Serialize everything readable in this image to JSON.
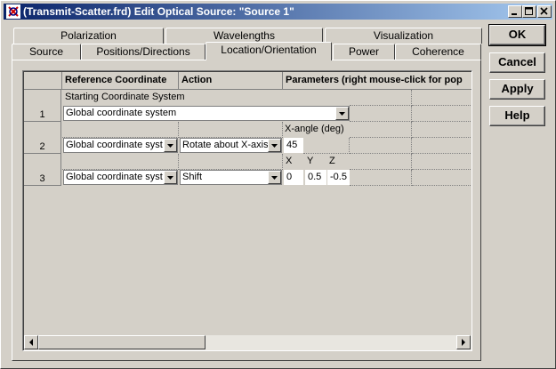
{
  "window": {
    "title": "(Transmit-Scatter.frd) Edit Optical Source: \"Source 1\""
  },
  "tabs": {
    "row1": [
      "Polarization",
      "Wavelengths",
      "Visualization"
    ],
    "row2": [
      "Source",
      "Positions/Directions",
      "Location/Orientation",
      "Power",
      "Coherence"
    ],
    "active": "Location/Orientation"
  },
  "grid": {
    "headers": [
      "Reference Coordinate",
      "Action",
      "Parameters (right mouse-click for pop"
    ],
    "rows": [
      {
        "number": "1",
        "label": "Starting Coordinate System",
        "reference": "Global coordinate system"
      },
      {
        "number": "2",
        "reference": "Global coordinate syst",
        "action": "Rotate about X-axis",
        "param_label": "X-angle (deg)",
        "param_value": "45"
      },
      {
        "number": "3",
        "reference": "Global coordinate syst",
        "action": "Shift",
        "param_labels": [
          "X",
          "Y",
          "Z"
        ],
        "param_values": [
          "0",
          "0.5",
          "-0.5"
        ]
      }
    ]
  },
  "buttons": {
    "ok": "OK",
    "cancel": "Cancel",
    "apply": "Apply",
    "help": "Help"
  }
}
